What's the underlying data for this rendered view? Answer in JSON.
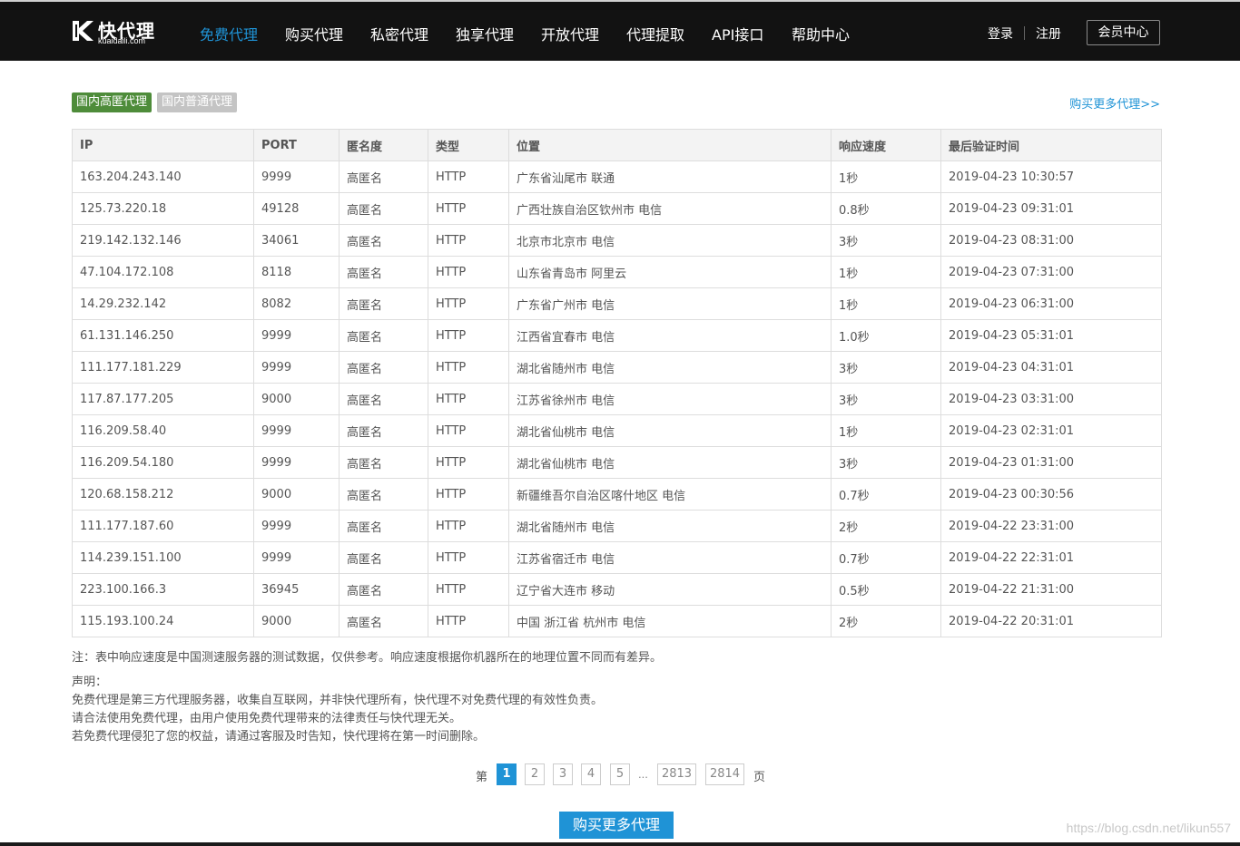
{
  "brand": {
    "name": "快代理",
    "domain": "kuaidaili.com",
    "logo_icon": "k-logo-icon"
  },
  "nav": {
    "items": [
      "免费代理",
      "购买代理",
      "私密代理",
      "独享代理",
      "开放代理",
      "代理提取",
      "API接口",
      "帮助中心"
    ],
    "active_index": 0,
    "login": "登录",
    "register": "注册",
    "member_center": "会员中心"
  },
  "tabs": {
    "high": "国内高匿代理",
    "normal": "国内普通代理"
  },
  "buy_more_link": "购买更多代理>>",
  "colors": {
    "accent": "#1f93d6",
    "header_bg": "#121212",
    "tag_active": "#4e8c3a",
    "tag_inactive": "#c4c4c4"
  },
  "table": {
    "headers": [
      "IP",
      "PORT",
      "匿名度",
      "类型",
      "位置",
      "响应速度",
      "最后验证时间"
    ],
    "rows": [
      [
        "163.204.243.140",
        "9999",
        "高匿名",
        "HTTP",
        "广东省汕尾市 联通",
        "1秒",
        "2019-04-23 10:30:57"
      ],
      [
        "125.73.220.18",
        "49128",
        "高匿名",
        "HTTP",
        "广西壮族自治区钦州市 电信",
        "0.8秒",
        "2019-04-23 09:31:01"
      ],
      [
        "219.142.132.146",
        "34061",
        "高匿名",
        "HTTP",
        "北京市北京市 电信",
        "3秒",
        "2019-04-23 08:31:00"
      ],
      [
        "47.104.172.108",
        "8118",
        "高匿名",
        "HTTP",
        "山东省青岛市 阿里云",
        "1秒",
        "2019-04-23 07:31:00"
      ],
      [
        "14.29.232.142",
        "8082",
        "高匿名",
        "HTTP",
        "广东省广州市 电信",
        "1秒",
        "2019-04-23 06:31:00"
      ],
      [
        "61.131.146.250",
        "9999",
        "高匿名",
        "HTTP",
        "江西省宜春市 电信",
        "1.0秒",
        "2019-04-23 05:31:01"
      ],
      [
        "111.177.181.229",
        "9999",
        "高匿名",
        "HTTP",
        "湖北省随州市 电信",
        "3秒",
        "2019-04-23 04:31:01"
      ],
      [
        "117.87.177.205",
        "9000",
        "高匿名",
        "HTTP",
        "江苏省徐州市 电信",
        "3秒",
        "2019-04-23 03:31:00"
      ],
      [
        "116.209.58.40",
        "9999",
        "高匿名",
        "HTTP",
        "湖北省仙桃市 电信",
        "1秒",
        "2019-04-23 02:31:01"
      ],
      [
        "116.209.54.180",
        "9999",
        "高匿名",
        "HTTP",
        "湖北省仙桃市 电信",
        "3秒",
        "2019-04-23 01:31:00"
      ],
      [
        "120.68.158.212",
        "9000",
        "高匿名",
        "HTTP",
        "新疆维吾尔自治区喀什地区 电信",
        "0.7秒",
        "2019-04-23 00:30:56"
      ],
      [
        "111.177.187.60",
        "9999",
        "高匿名",
        "HTTP",
        "湖北省随州市 电信",
        "2秒",
        "2019-04-22 23:31:00"
      ],
      [
        "114.239.151.100",
        "9999",
        "高匿名",
        "HTTP",
        "江苏省宿迁市 电信",
        "0.7秒",
        "2019-04-22 22:31:01"
      ],
      [
        "223.100.166.3",
        "36945",
        "高匿名",
        "HTTP",
        "辽宁省大连市 移动",
        "0.5秒",
        "2019-04-22 21:31:00"
      ],
      [
        "115.193.100.24",
        "9000",
        "高匿名",
        "HTTP",
        "中国 浙江省 杭州市 电信",
        "2秒",
        "2019-04-22 20:31:01"
      ]
    ]
  },
  "note": "注：表中响应速度是中国测速服务器的测试数据，仅供参考。响应速度根据你机器所在的地理位置不同而有差异。",
  "statement": {
    "title": "声明：",
    "lines": [
      "免费代理是第三方代理服务器，收集自互联网，并非快代理所有，快代理不对免费代理的有效性负责。",
      "请合法使用免费代理，由用户使用免费代理带来的法律责任与快代理无关。",
      "若免费代理侵犯了您的权益，请通过客服及时告知，快代理将在第一时间删除。"
    ]
  },
  "pagination": {
    "prefix": "第",
    "pages": [
      "1",
      "2",
      "3",
      "4",
      "5"
    ],
    "ellipsis": "...",
    "last_pages": [
      "2813",
      "2814"
    ],
    "current": "1",
    "suffix": "页"
  },
  "buy_button": "购买更多代理",
  "watermark": "https://blog.csdn.net/likun557"
}
